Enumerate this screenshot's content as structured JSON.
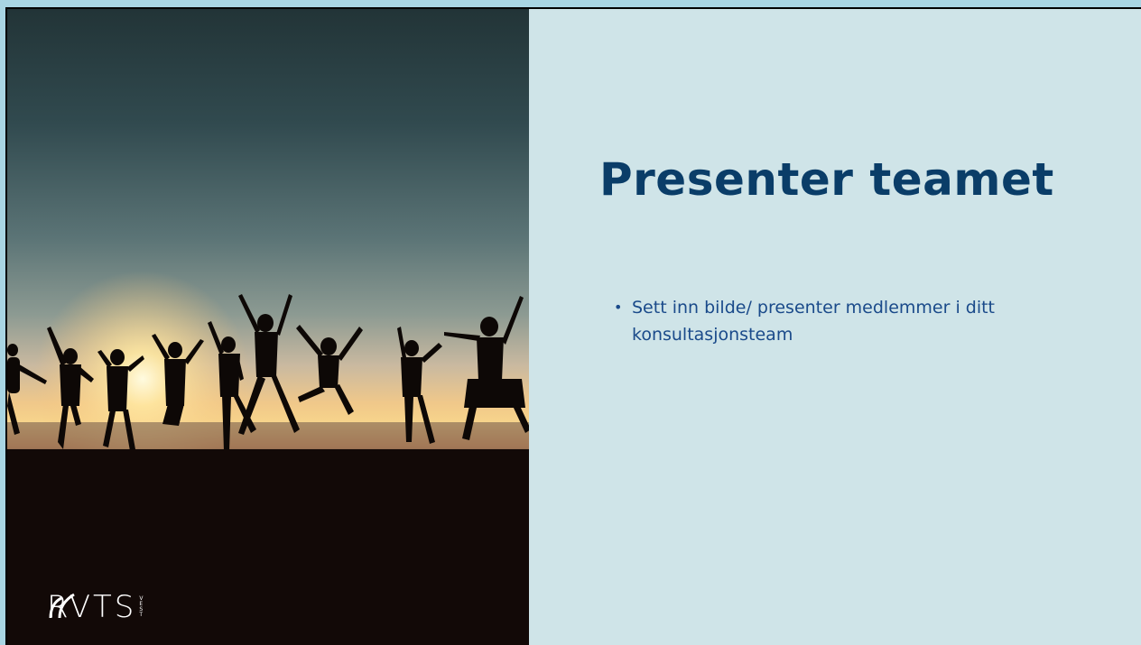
{
  "slide": {
    "title": "Presenter teamet",
    "bullets": [
      "Sett inn bilde/ presenter medlemmer i ditt konsultasjonsteam"
    ],
    "bullet_symbol": "•"
  },
  "image": {
    "subject": "silhouettes jumping on beach at sunset"
  },
  "logo": {
    "text": "RVTS",
    "sub_letters": [
      "V",
      "E",
      "S",
      "T"
    ]
  },
  "colors": {
    "background": "#a9d5e3",
    "content_panel": "#cfe4e8",
    "title": "#0a3d68",
    "bullet_text": "#1a4a8a"
  }
}
